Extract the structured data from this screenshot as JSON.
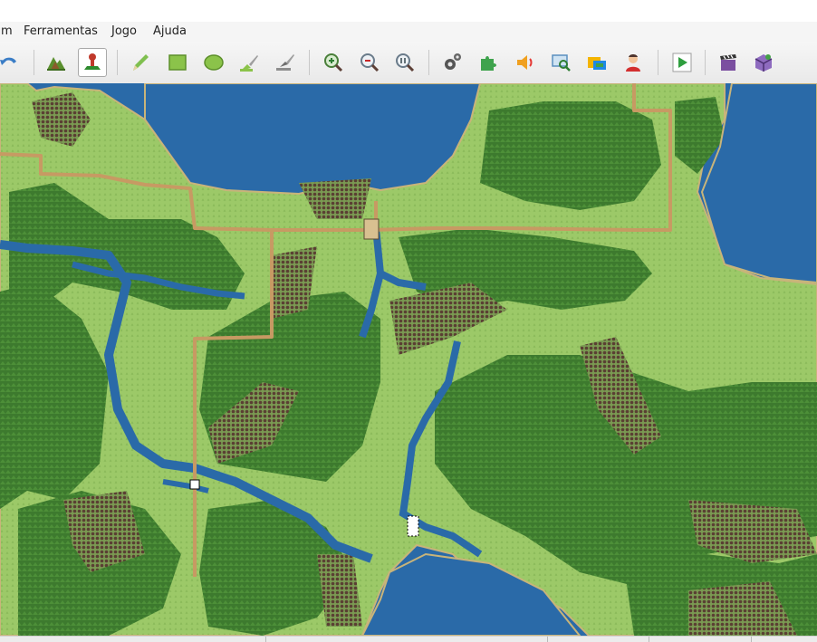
{
  "menubar": {
    "items": [
      "m",
      "Ferramentas",
      "Jogo",
      "Ajuda"
    ]
  },
  "toolbar": {
    "buttons": [
      {
        "name": "undo",
        "icon": "undo-arrow-icon"
      },
      {
        "name": "map-layer",
        "icon": "mountain-layer-icon"
      },
      {
        "name": "event-layer",
        "icon": "character-pin-icon",
        "active": true
      },
      {
        "name": "pencil",
        "icon": "pencil-icon"
      },
      {
        "name": "rectangle",
        "icon": "rectangle-icon"
      },
      {
        "name": "ellipse",
        "icon": "ellipse-icon"
      },
      {
        "name": "fill",
        "icon": "fill-brush-icon"
      },
      {
        "name": "select",
        "icon": "select-brush-icon"
      },
      {
        "name": "zoom-in",
        "icon": "zoom-in-icon"
      },
      {
        "name": "zoom-out",
        "icon": "zoom-out-icon"
      },
      {
        "name": "zoom-actual",
        "icon": "zoom-actual-size-icon"
      },
      {
        "name": "database",
        "icon": "gears-icon"
      },
      {
        "name": "plugins",
        "icon": "puzzle-icon"
      },
      {
        "name": "sound",
        "icon": "speaker-icon"
      },
      {
        "name": "event-search",
        "icon": "search-screen-icon"
      },
      {
        "name": "resources",
        "icon": "resource-manager-icon"
      },
      {
        "name": "character-generator",
        "icon": "character-icon"
      },
      {
        "name": "playtest",
        "icon": "play-icon"
      },
      {
        "name": "movie",
        "icon": "clapper-icon"
      },
      {
        "name": "deploy",
        "icon": "package-icon"
      }
    ]
  },
  "colors": {
    "water": "#2a6aa8",
    "grass": "#9cc968",
    "forest": "#3d7a2e",
    "hills": "#6b4a3a",
    "road": "#c79a63",
    "accent": "#1d6fc1"
  }
}
